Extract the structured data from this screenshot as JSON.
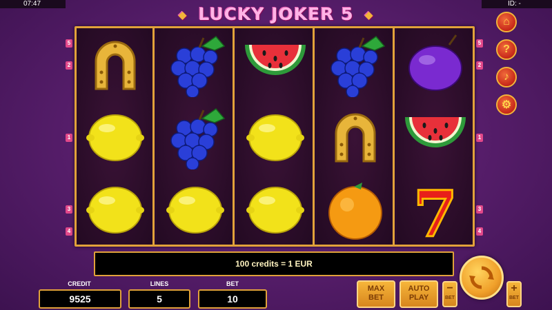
{
  "status_bar": {
    "time": "07:47",
    "id_label": "ID: -"
  },
  "title": {
    "text": "LUCKY JOKER 5",
    "deco": "◆"
  },
  "reels": [
    [
      "horseshoe",
      "lemon",
      "lemon"
    ],
    [
      "grapes",
      "grapes",
      "lemon"
    ],
    [
      "watermelon",
      "lemon",
      "lemon"
    ],
    [
      "grapes",
      "horseshoe",
      "orange"
    ],
    [
      "plum",
      "watermelon",
      "seven"
    ]
  ],
  "paylines": {
    "left": [
      {
        "num": "5"
      },
      {
        "num": "2"
      },
      {
        "num": "1"
      },
      {
        "num": "3"
      },
      {
        "num": "4"
      }
    ],
    "right": [
      {
        "num": "5"
      },
      {
        "num": "2"
      },
      {
        "num": "1"
      },
      {
        "num": "3"
      },
      {
        "num": "4"
      }
    ]
  },
  "side_buttons": [
    {
      "icon": "home-icon",
      "glyph": "⌂"
    },
    {
      "icon": "help-icon",
      "glyph": "?"
    },
    {
      "icon": "sound-icon",
      "glyph": "♪"
    },
    {
      "icon": "settings-icon",
      "glyph": "⚙"
    }
  ],
  "message": "100 credits = 1 EUR",
  "stats": {
    "credit": {
      "label": "CREDIT",
      "value": "9525"
    },
    "lines": {
      "label": "LINES",
      "value": "5"
    },
    "bet": {
      "label": "BET",
      "value": "10"
    }
  },
  "controls": {
    "max_bet": {
      "line1": "MAX",
      "line2": "BET"
    },
    "auto_play": {
      "line1": "AUTO",
      "line2": "PLAY"
    },
    "bet_minus": {
      "sym": "−",
      "cap": "BET"
    },
    "bet_plus": {
      "sym": "+",
      "cap": "BET"
    }
  },
  "colors": {
    "frame_gold": "#e2a23a",
    "background": "#5a1f6e",
    "side_button": "#c7281a",
    "control_button": "#f0a02a"
  }
}
